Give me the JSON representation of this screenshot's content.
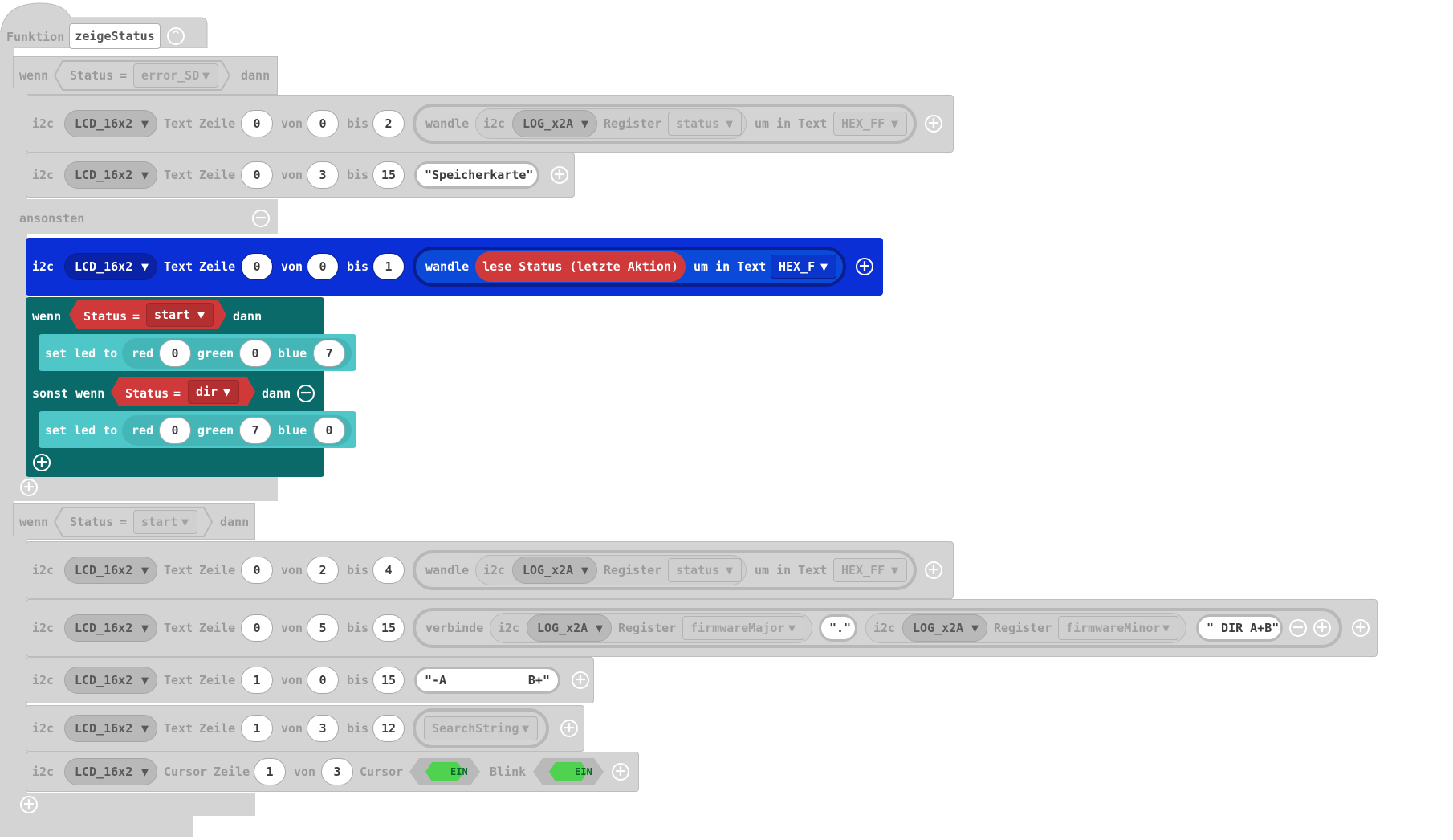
{
  "func": {
    "keyword": "Funktion",
    "name": "zeigeStatus"
  },
  "if1": {
    "wenn": "wenn",
    "var": "Status",
    "eq": "=",
    "value": "error_SD",
    "dann": "dann"
  },
  "row1": {
    "i2c": "i2c",
    "dev": "LCD_16x2",
    "text": "Text",
    "zeile": "Zeile",
    "z": "0",
    "von": "von",
    "v": "0",
    "bis": "bis",
    "b": "2",
    "wandle": "wandle",
    "i2c2": "i2c",
    "dev2": "LOG_x2A",
    "register": "Register",
    "reg": "status",
    "umin": "um in Text",
    "fmt": "HEX_FF"
  },
  "row2": {
    "i2c": "i2c",
    "dev": "LCD_16x2",
    "text": "Text",
    "zeile": "Zeile",
    "z": "0",
    "von": "von",
    "v": "3",
    "bis": "bis",
    "b": "15",
    "str": "\"Speicherkarte\""
  },
  "else1": {
    "label": "ansonsten"
  },
  "row3": {
    "i2c": "i2c",
    "dev": "LCD_16x2",
    "text": "Text",
    "zeile": "Zeile",
    "z": "0",
    "von": "von",
    "v": "0",
    "bis": "bis",
    "b": "1",
    "wandle": "wandle",
    "reader": "lese Status (letzte Aktion)",
    "umin": "um in Text",
    "fmt": "HEX_F"
  },
  "if2": {
    "wenn": "wenn",
    "var": "Status",
    "eq": "=",
    "value": "start",
    "dann": "dann"
  },
  "led1": {
    "set": "set led to",
    "red": "red",
    "r": "0",
    "green": "green",
    "g": "0",
    "blue": "blue",
    "b": "7"
  },
  "elif2": {
    "sonst": "sonst wenn",
    "var": "Status",
    "eq": "=",
    "value": "dir",
    "dann": "dann"
  },
  "led2": {
    "set": "set led to",
    "red": "red",
    "r": "0",
    "green": "green",
    "g": "7",
    "blue": "blue",
    "b": "0"
  },
  "if3": {
    "wenn": "wenn",
    "var": "Status",
    "eq": "=",
    "value": "start",
    "dann": "dann"
  },
  "row4": {
    "i2c": "i2c",
    "dev": "LCD_16x2",
    "text": "Text",
    "zeile": "Zeile",
    "z": "0",
    "von": "von",
    "v": "2",
    "bis": "bis",
    "b": "4",
    "wandle": "wandle",
    "i2c2": "i2c",
    "dev2": "LOG_x2A",
    "register": "Register",
    "reg": "status",
    "umin": "um in Text",
    "fmt": "HEX_FF"
  },
  "row5": {
    "i2c": "i2c",
    "dev": "LCD_16x2",
    "text": "Text",
    "zeile": "Zeile",
    "z": "0",
    "von": "von",
    "v": "5",
    "bis": "bis",
    "b": "15",
    "verbinde": "verbinde",
    "i2c2": "i2c",
    "dev2": "LOG_x2A",
    "register": "Register",
    "reg": "firmwareMajor",
    "dot": "\".\"",
    "i2c3": "i2c",
    "dev3": "LOG_x2A",
    "register2": "Register",
    "reg2": "firmwareMinor",
    "str": "\" DIR A+B\""
  },
  "row6": {
    "i2c": "i2c",
    "dev": "LCD_16x2",
    "text": "Text",
    "zeile": "Zeile",
    "z": "1",
    "von": "von",
    "v": "0",
    "bis": "bis",
    "b": "15",
    "str1": "\"-A",
    "str2": "B+\""
  },
  "row7": {
    "i2c": "i2c",
    "dev": "LCD_16x2",
    "text": "Text",
    "zeile": "Zeile",
    "z": "1",
    "von": "von",
    "v": "3",
    "bis": "bis",
    "b": "12",
    "var": "SearchString"
  },
  "row8": {
    "i2c": "i2c",
    "dev": "LCD_16x2",
    "cursor": "Cursor",
    "zeile": "Zeile",
    "z": "1",
    "von": "von",
    "v": "3",
    "cursor2": "Cursor",
    "ein1": "EIN",
    "blink": "Blink",
    "ein2": "EIN"
  },
  "icons": {
    "add": "+",
    "remove": "−",
    "collapse": "^",
    "arrow": "▼"
  },
  "colors": {
    "disabled": "#d4d4d4",
    "blue": "#0b2fd6",
    "teal": "#0a6a6a",
    "cyan": "#4fc7c8",
    "red": "#d0393a",
    "green": "#4fd24f"
  }
}
